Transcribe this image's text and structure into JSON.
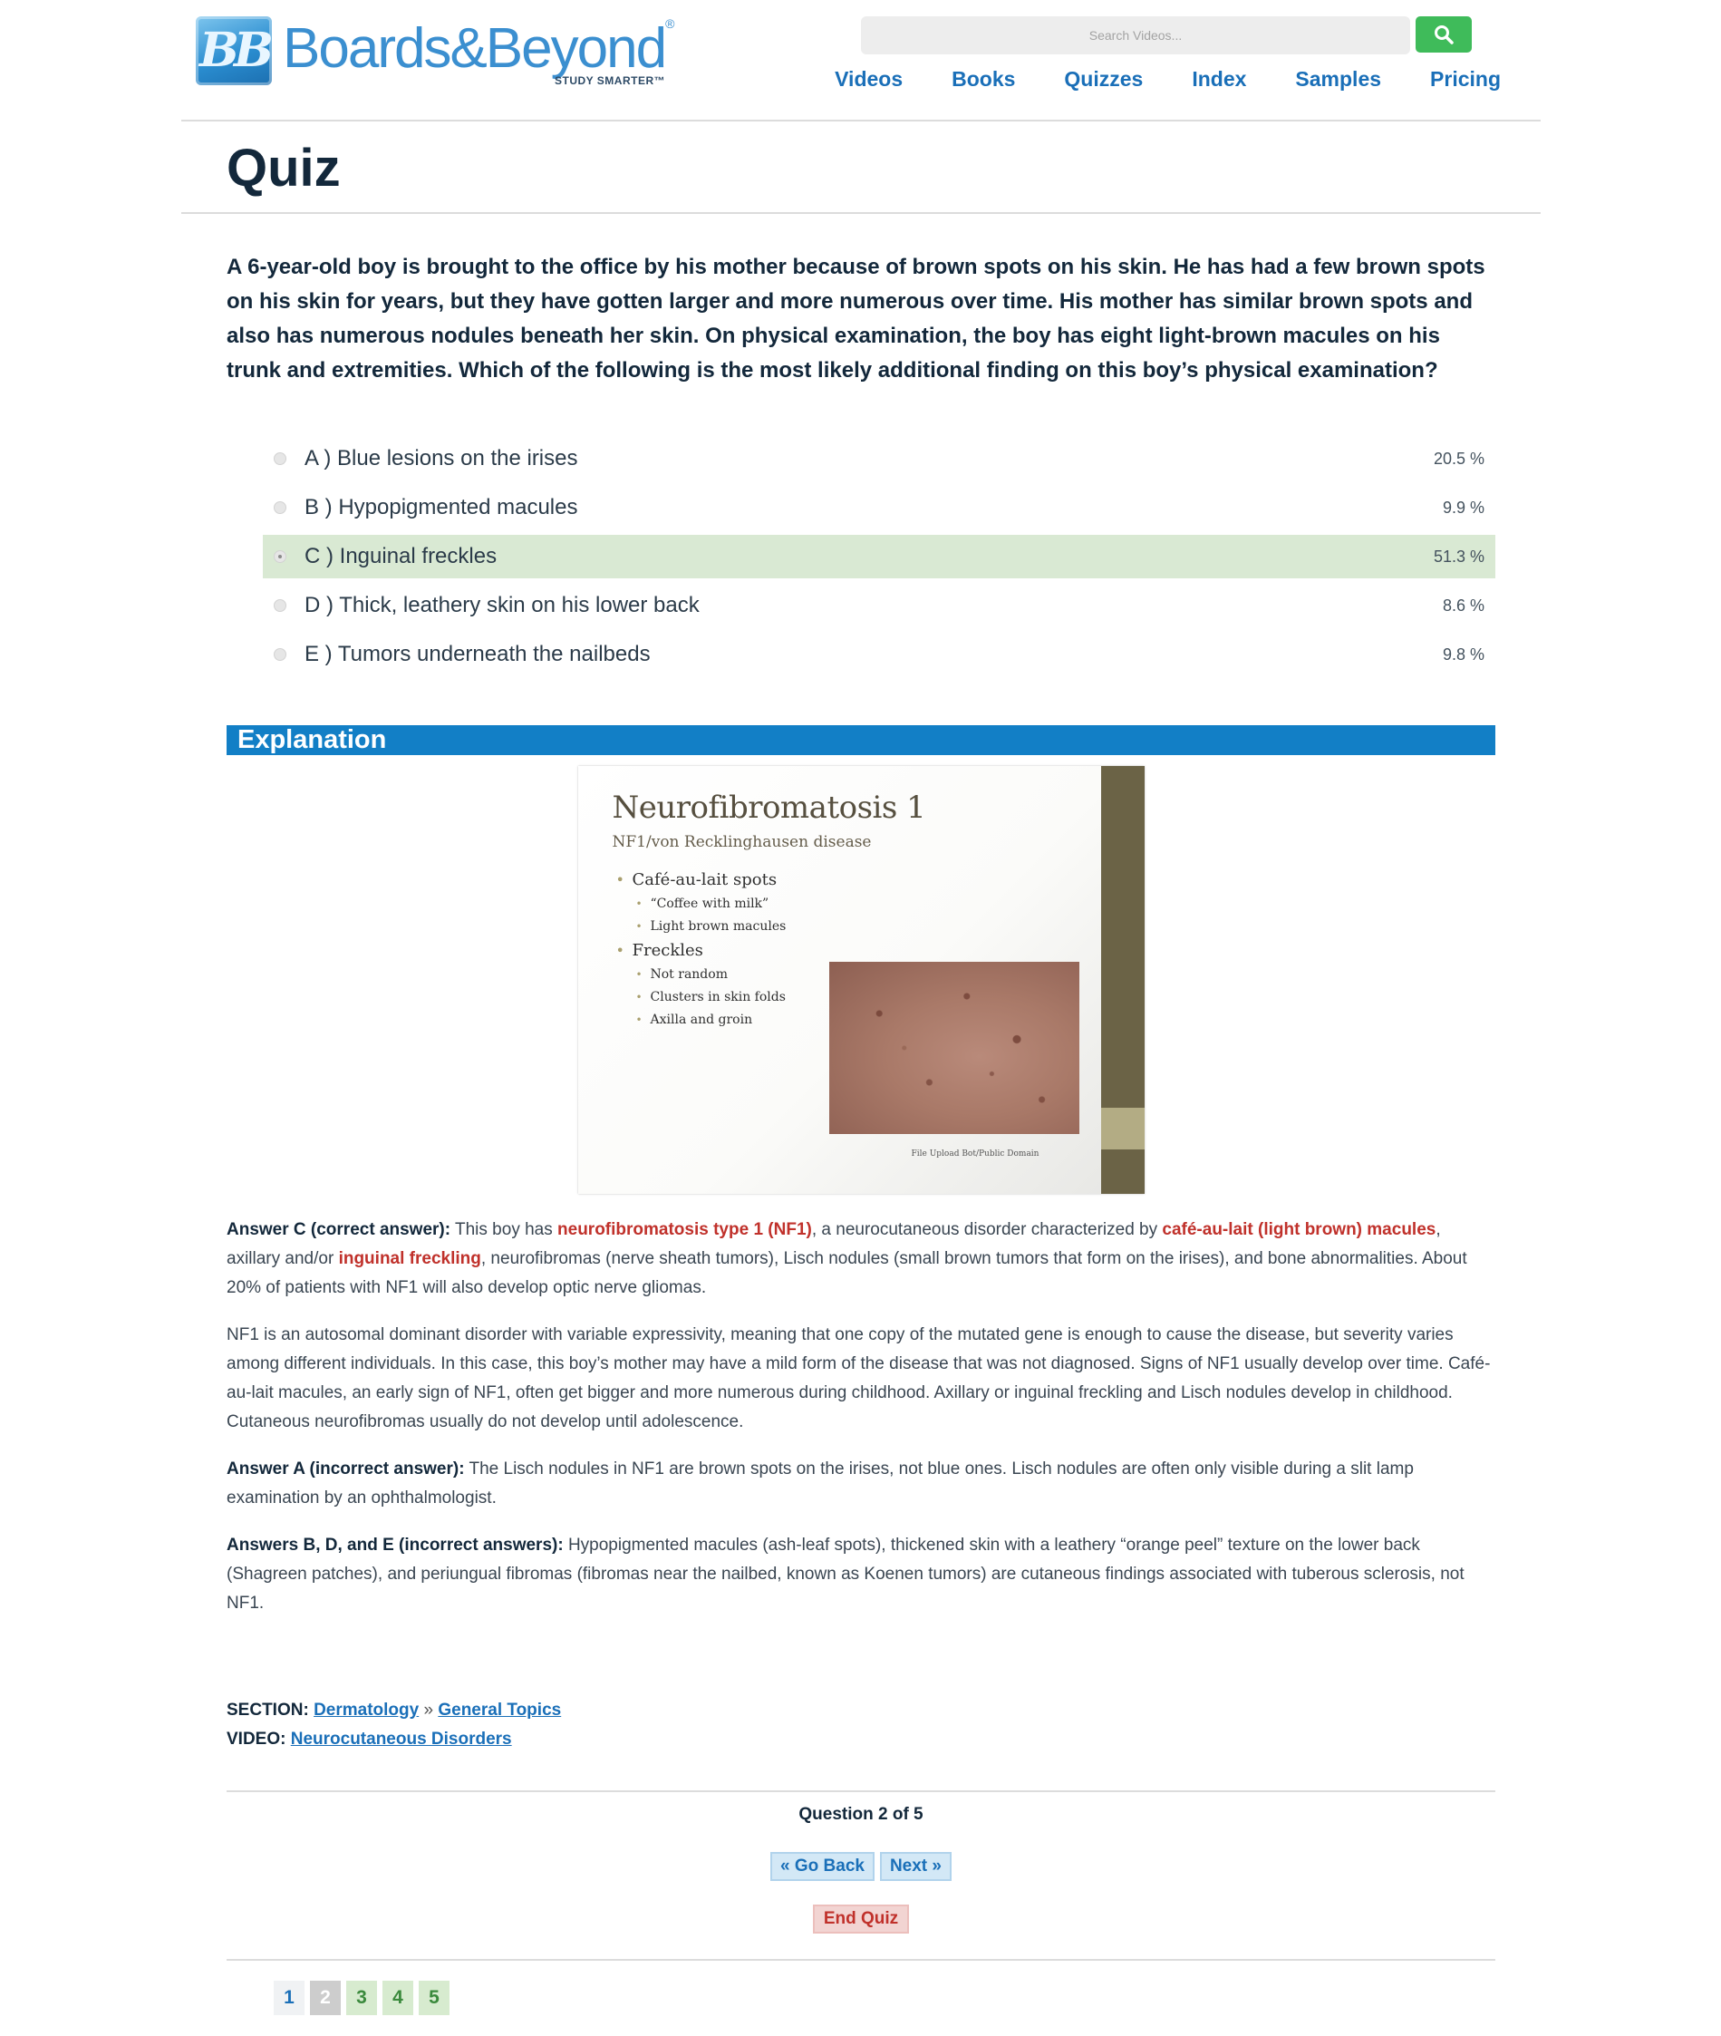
{
  "header": {
    "logo_mark": "BB",
    "logo_text": "Boards&Beyond",
    "logo_registered": "®",
    "logo_tagline": "STUDY SMARTER™",
    "search_placeholder": "Search Videos...",
    "nav": [
      "Videos",
      "Books",
      "Quizzes",
      "Index",
      "Samples",
      "Pricing"
    ]
  },
  "page_title": "Quiz",
  "question": "A 6-year-old boy is brought to the office by his mother because of brown spots on his skin. He has had a few brown spots on his skin for years, but they have gotten larger and more numerous over time. His mother has similar brown spots and also has numerous nodules beneath her skin. On physical examination, the boy has eight light-brown macules on his trunk and extremities. Which of the following is the most likely additional finding on this boy’s physical examination?",
  "choices": [
    {
      "label": "A ) Blue lesions on the irises",
      "pct": "20.5 %",
      "pct_value": 20.5
    },
    {
      "label": "B ) Hypopigmented macules",
      "pct": "9.9 %",
      "pct_value": 9.9
    },
    {
      "label": "C ) Inguinal freckles",
      "pct": "51.3 %",
      "pct_value": 51.3,
      "selected": true,
      "correct": true
    },
    {
      "label": "D ) Thick, leathery skin on his lower back",
      "pct": "8.6 %",
      "pct_value": 8.6
    },
    {
      "label": "E ) Tumors underneath the nailbeds",
      "pct": "9.8 %",
      "pct_value": 9.8
    }
  ],
  "explanation_heading": "Explanation",
  "slide": {
    "title": "Neurofibromatosis 1",
    "subtitle": "NF1/von Recklinghausen disease",
    "items": [
      {
        "text": "Café-au-lait spots",
        "sub": [
          "“Coffee with milk”",
          "Light brown macules"
        ]
      },
      {
        "text": "Freckles",
        "sub": [
          "Not random",
          "Clusters in skin folds",
          "Axilla and groin"
        ]
      }
    ],
    "credit": "File Upload Bot/Public Domain"
  },
  "explanation": {
    "p1": {
      "lead": "Answer C (correct answer):",
      "t1": " This boy has ",
      "h1": "neurofibromatosis type 1 (NF1)",
      "t2": ", a neurocutaneous disorder characterized by ",
      "h2": "café-au-lait (light brown) macules",
      "t3": ", axillary and/or ",
      "h3": "inguinal freckling",
      "t4": ", neurofibromas (nerve sheath tumors), Lisch nodules (small brown tumors that form on the irises), and bone abnormalities. About 20% of patients with NF1 will also develop optic nerve gliomas."
    },
    "p2": "NF1 is an autosomal dominant disorder with variable expressivity, meaning that one copy of the mutated gene is enough to cause the disease, but severity varies among different individuals. In this case, this boy’s mother may have a mild form of the disease that was not diagnosed. Signs of NF1 usually develop over time. Café-au-lait macules, an early sign of NF1, often get bigger and more numerous during childhood. Axillary or inguinal freckling and Lisch nodules develop in childhood. Cutaneous neurofibromas usually do not develop until adolescence.",
    "p3": {
      "lead": "Answer A (incorrect answer):",
      "text": " The Lisch nodules in NF1 are brown spots on the irises, not blue ones. Lisch nodules are often only visible during a slit lamp examination by an ophthalmologist."
    },
    "p4": {
      "lead": "Answers B, D, and E (incorrect answers):",
      "text": " Hypopigmented macules (ash-leaf spots), thickened skin with a leathery “orange peel” texture on the lower back (Shagreen patches), and periungual fibromas (fibromas near the nailbed, known as Koenen tumors) are cutaneous findings associated with tuberous sclerosis, not NF1."
    }
  },
  "meta": {
    "section_label": "SECTION:",
    "section_link": "Dermatology",
    "separator": "»",
    "topic_link": "General Topics",
    "video_label": "VIDEO:",
    "video_link": "Neurocutaneous Disorders"
  },
  "navigation": {
    "question_count": "Question 2 of 5",
    "go_back": "« Go Back",
    "next": "Next »",
    "end_quiz": "End Quiz",
    "pages": [
      "1",
      "2",
      "3",
      "4",
      "5"
    ]
  },
  "colors": {
    "brand_blue": "#1a6fb8",
    "explanation_bar": "#127fc6",
    "correct_highlight": "#d9e9d3",
    "search_green": "#3fbb5a",
    "highlight_red": "#c0312b"
  }
}
